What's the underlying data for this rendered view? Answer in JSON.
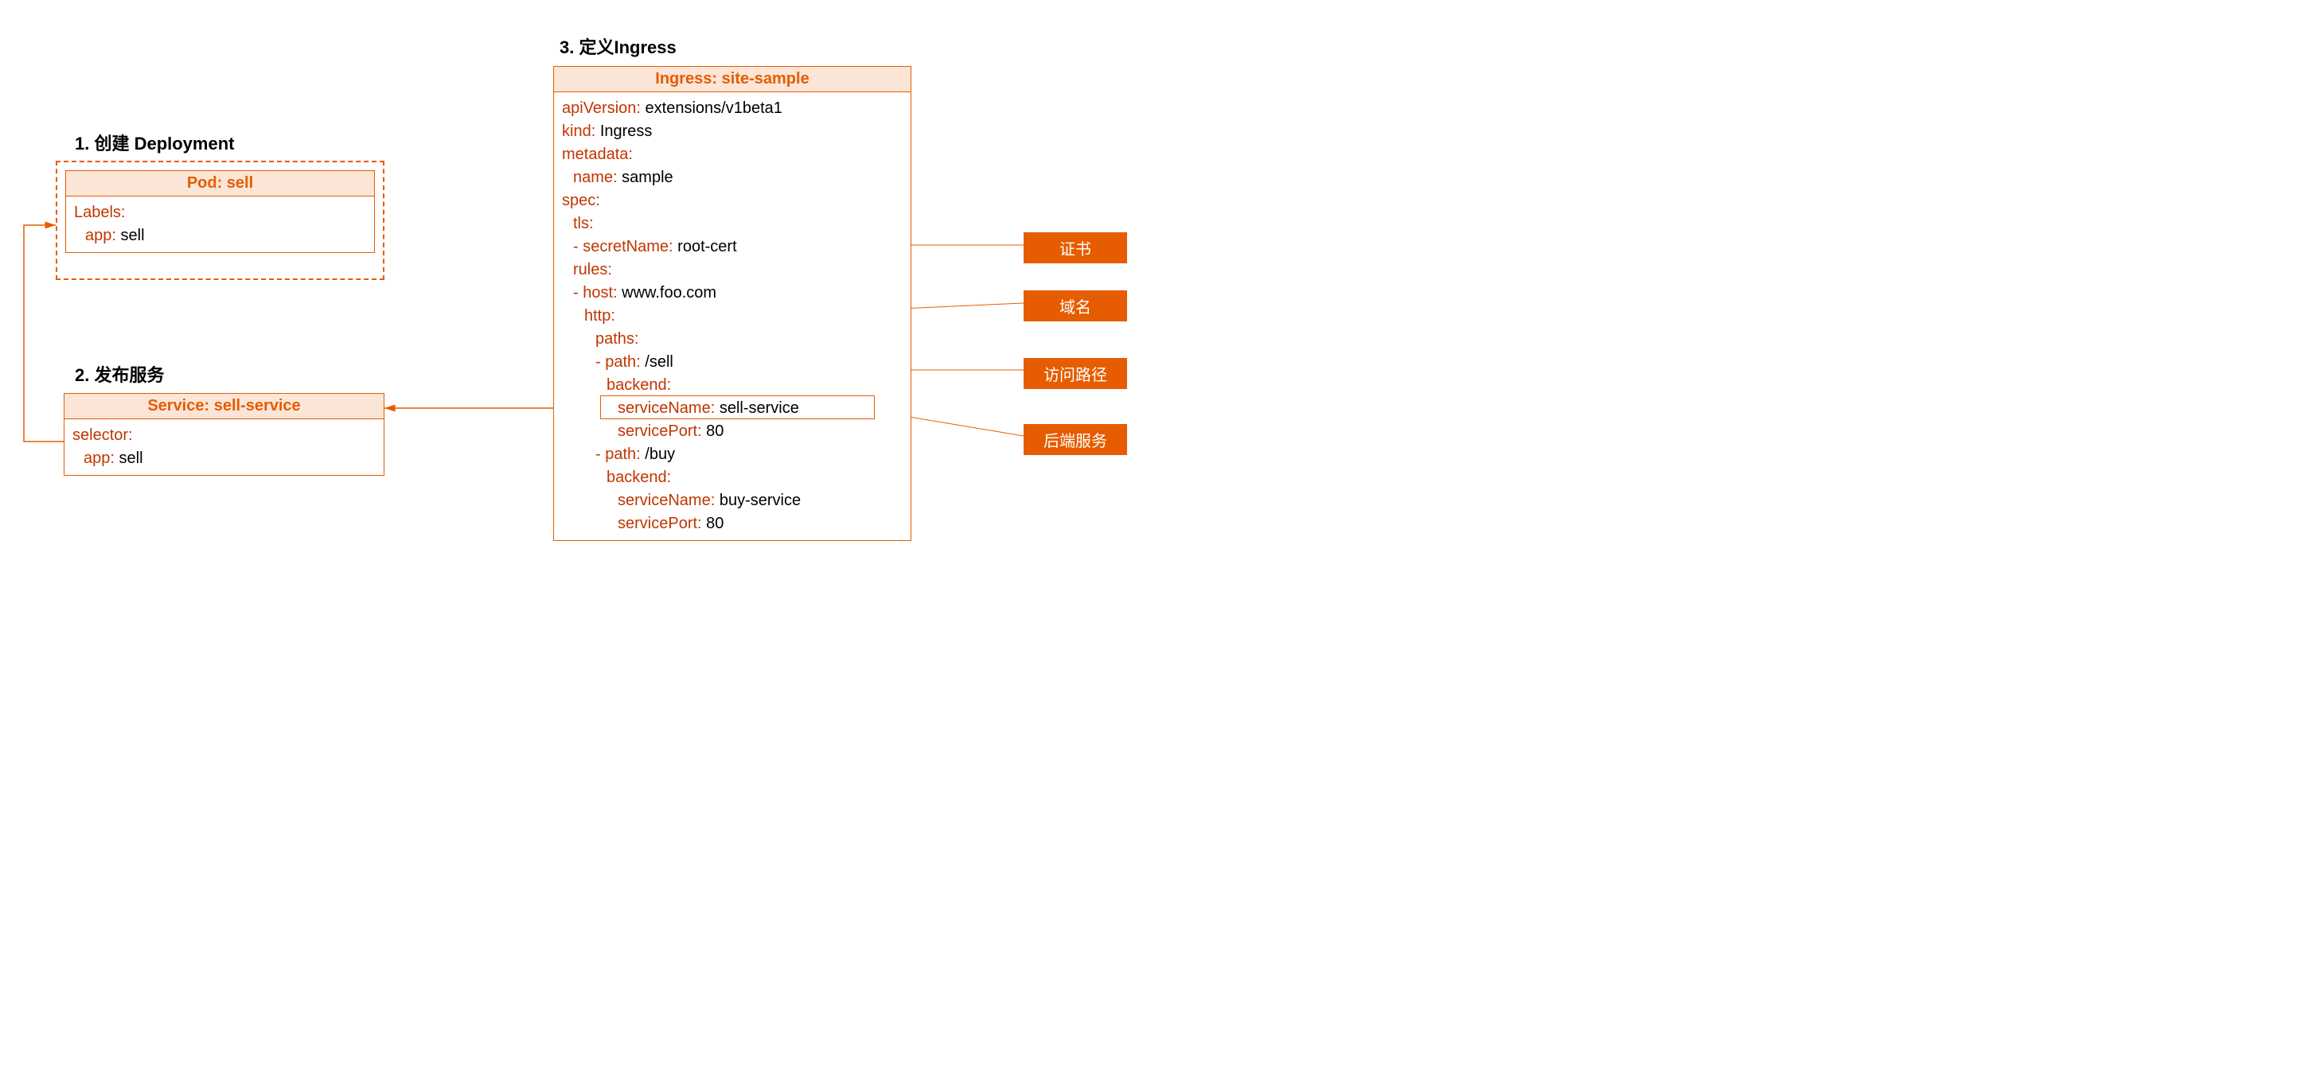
{
  "deployment": {
    "title": "1. 创建 Deployment",
    "header": "Pod: sell",
    "labelsKey": "Labels:",
    "appKey": "app:",
    "appVal": "sell"
  },
  "service": {
    "title": "2. 发布服务",
    "header": "Service: sell-service",
    "selectorKey": "selector:",
    "appKey": "app:",
    "appVal": "sell"
  },
  "ingress": {
    "title": "3. 定义Ingress",
    "header": "Ingress: site-sample",
    "apiVersionKey": "apiVersion:",
    "apiVersionVal": "extensions/v1beta1",
    "kindKey": "kind:",
    "kindVal": "Ingress",
    "metadataKey": "metadata:",
    "nameKey": "name:",
    "nameVal": "sample",
    "specKey": "spec:",
    "tlsKey": "tls:",
    "secretNameKey": "- secretName:",
    "secretNameVal": "root-cert",
    "rulesKey": "rules:",
    "hostKey": "- host:",
    "hostVal": "www.foo.com",
    "httpKey": "http:",
    "pathsKey": "paths:",
    "path1Key": "- path:",
    "path1Val": "/sell",
    "backendKey": "backend:",
    "serviceNameKey": "serviceName:",
    "serviceName1Val": "sell-service",
    "servicePortKey": "servicePort:",
    "servicePort1Val": "80",
    "path2Key": "- path:",
    "path2Val": "/buy",
    "serviceName2Val": "buy-service",
    "servicePort2Val": "80"
  },
  "tags": {
    "cert": "证书",
    "domain": "域名",
    "path": "访问路径",
    "backend": "后端服务"
  }
}
